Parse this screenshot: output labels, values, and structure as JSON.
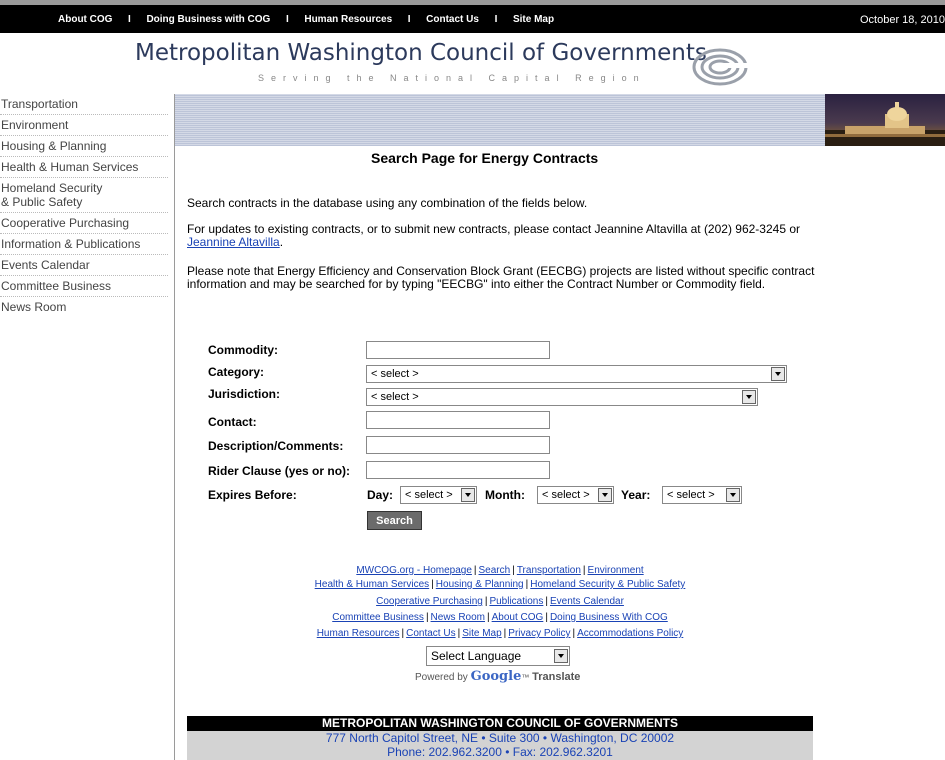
{
  "topbar": {
    "nav": [
      "About COG",
      "Doing Business with COG",
      "Human Resources",
      "Contact Us",
      "Site Map"
    ],
    "separator": "I",
    "date": "October 18, 2010"
  },
  "header": {
    "title": "Metropolitan Washington Council of Governments",
    "tagline": "Serving the National Capital Region",
    "logo_icon": "cog-spiral-logo"
  },
  "leftnav": [
    "Transportation",
    "Environment",
    "Housing & Planning",
    "Health & Human Services",
    "Homeland Security",
    "& Public Safety",
    "Cooperative Purchasing",
    "Information & Publications",
    "Events Calendar",
    "Committee Business",
    "News Room"
  ],
  "main": {
    "title": "Search Page for Energy Contracts",
    "intro": "Search contracts in the database using any combination of the fields below.",
    "updates_text": "For updates to existing contracts, or to submit new contracts, please contact Jeannine Altavilla at (202) 962-3245 or",
    "updates_link": "Jeannine Altavilla",
    "updates_end": ".",
    "note": "Please note that Energy Efficiency and Conservation Block Grant (EECBG) projects are listed without specific contract information and may be searched for by typing \"EECBG\" into either the Contract Number or Commodity field."
  },
  "form": {
    "commodity_label": "Commodity:",
    "category_label": "Category:",
    "category_value": "< select >",
    "jurisdiction_label": "Jurisdiction:",
    "jurisdiction_value": "< select >",
    "contact_label": "Contact:",
    "description_label": "Description/Comments:",
    "rider_label": "Rider Clause (yes or no):",
    "expires_label": "Expires Before:",
    "day_label": "Day:",
    "day_value": "< select >",
    "month_label": "Month:",
    "month_value": "< select >",
    "year_label": "Year:",
    "year_value": "< select >",
    "search_button": "Search"
  },
  "footer_links": {
    "row1": [
      "MWCOG.org - Homepage",
      "Search",
      "Transportation",
      "Environment"
    ],
    "row2": [
      "Health & Human Services",
      "Housing & Planning",
      "Homeland Security & Public Safety"
    ],
    "row3": [
      "Cooperative Purchasing",
      "Publications",
      "Events Calendar"
    ],
    "row4": [
      "Committee Business",
      "News Room",
      "About COG",
      "Doing Business With COG"
    ],
    "row5": [
      "Human Resources",
      "Contact Us",
      "Site Map",
      "Privacy Policy",
      "Accommodations Policy"
    ],
    "separator": "|"
  },
  "translate": {
    "select_value": "Select Language",
    "powered_by": "Powered by",
    "google": "Google",
    "tm": "™",
    "translate": "Translate"
  },
  "footer": {
    "org": "METROPOLITAN WASHINGTON COUNCIL OF GOVERNMENTS",
    "address": "777 North Capitol Street, NE • Suite 300 • Washington, DC 20002",
    "phone": "Phone: 202.962.3200 • Fax: 202.962.3201"
  }
}
